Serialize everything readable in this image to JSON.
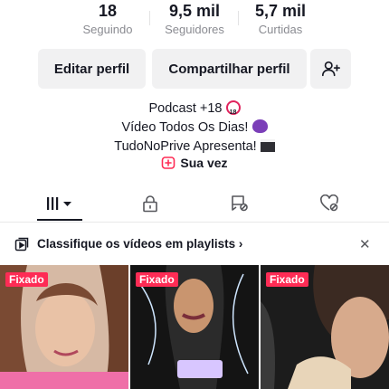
{
  "stats": [
    {
      "value": "18",
      "label": "Seguindo"
    },
    {
      "value": "9,5 mil",
      "label": "Seguidores"
    },
    {
      "value": "5,7 mil",
      "label": "Curtidas"
    }
  ],
  "actions": {
    "edit_label": "Editar perfil",
    "share_label": "Compartilhar perfil",
    "add_friend_icon": "add-user-icon"
  },
  "bio": {
    "line1": "Podcast +18",
    "line2": "Vídeo Todos Os Dias!",
    "line3": "TudoNoPrive Apresenta!"
  },
  "your_turn": {
    "label": "Sua vez"
  },
  "tabs": [
    {
      "icon": "videos-grid-icon",
      "active": true
    },
    {
      "icon": "lock-icon"
    },
    {
      "icon": "tagged-icon"
    },
    {
      "icon": "liked-hidden-icon"
    }
  ],
  "playlist_banner": {
    "text": "Classifique os vídeos em playlists",
    "chevron": "›"
  },
  "videos": [
    {
      "pinned_label": "Fixado"
    },
    {
      "pinned_label": "Fixado"
    },
    {
      "pinned_label": "Fixado"
    }
  ],
  "colors": {
    "accent": "#fe2c55",
    "text": "#161823",
    "muted": "#8a8b91",
    "button_bg": "#f1f1f2"
  }
}
